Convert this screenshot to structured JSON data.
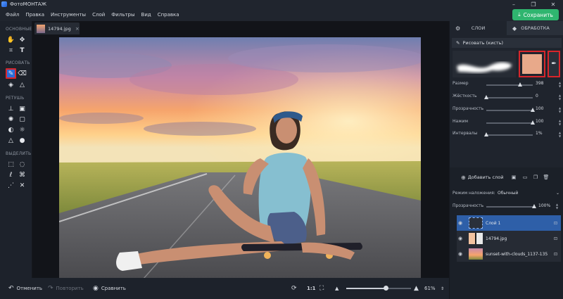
{
  "app": {
    "title": "ФотоМОНТАЖ",
    "window_controls": [
      "–",
      "❐",
      "✕"
    ]
  },
  "menu": {
    "items": [
      "Файл",
      "Правка",
      "Инструменты",
      "Слой",
      "Фильтры",
      "Вид",
      "Справка"
    ],
    "save_label": "Сохранить"
  },
  "toolbar": {
    "sections": [
      "ОСНОВНЫЕ",
      "РИСОВАТЬ",
      "РЕТУШЬ",
      "ВЫДЕЛИТЬ"
    ]
  },
  "document": {
    "tab_name": "14794.jpg"
  },
  "bottombar": {
    "undo_label": "Отменить",
    "redo_label": "Повторить",
    "compare_label": "Сравнить",
    "ratio_label": "1:1",
    "zoom_value": "61%",
    "zoom_level": 0.61
  },
  "panel": {
    "tabs": [
      "СЛОИ",
      "ОБРАБОТКА"
    ],
    "brush_title": "Рисовать (кисть)",
    "brush_color": "#e8a98a",
    "params": [
      {
        "label": "Размер",
        "value": "398",
        "level": 0.72
      },
      {
        "label": "Жёсткость",
        "value": "0",
        "level": 0.0
      },
      {
        "label": "Прозрачность",
        "value": "100",
        "level": 1.0
      },
      {
        "label": "Нажим",
        "value": "100",
        "level": 1.0
      },
      {
        "label": "Интервалы",
        "value": "1%",
        "level": 0.0
      }
    ],
    "add_layer_label": "Добавить слой",
    "blend_label": "Режим наложения:",
    "blend_value": "Обычный",
    "opacity_label": "Прозрачность",
    "opacity_value": "100%",
    "opacity_level": 1.0,
    "layers": [
      {
        "name": "Слой 1",
        "active": true
      },
      {
        "name": "14794.jpg",
        "active": false
      },
      {
        "name": "sunset-with-clouds_1137-135",
        "active": false
      }
    ]
  }
}
